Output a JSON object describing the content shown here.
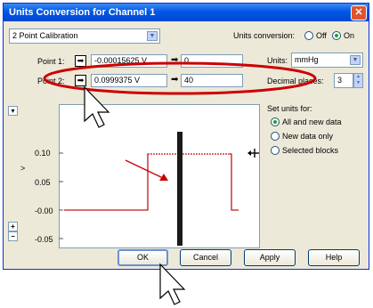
{
  "window": {
    "title": "Units Conversion for Channel 1",
    "close_glyph": "✕"
  },
  "calibration": {
    "mode_value": "2 Point Calibration"
  },
  "units_conversion": {
    "label": "Units conversion:",
    "off_label": "Off",
    "on_label": "On",
    "selected": "On"
  },
  "points": [
    {
      "label": "Point 1:",
      "raw_value": "-0.00015625 V",
      "converted_value": "0"
    },
    {
      "label": "Point 2:",
      "raw_value": "0.0999375 V",
      "converted_value": "40"
    }
  ],
  "units": {
    "label": "Units:",
    "value": "mmHg"
  },
  "decimal_places": {
    "label": "Decimal places:",
    "value": "3"
  },
  "set_units_for": {
    "label": "Set units for:",
    "options": [
      "All and new data",
      "New data only",
      "Selected blocks"
    ],
    "selected": "All and new data"
  },
  "chart": {
    "y_axis_symbol": ">",
    "tick_labels": [
      "0.10",
      "0.05",
      "-0.00",
      "-0.05"
    ],
    "signal_color": "#c4161c",
    "annotation_color": "#cc0000"
  },
  "footer": {
    "ok_label": "OK",
    "cancel_label": "Cancel",
    "apply_label": "Apply",
    "help_label": "Help"
  },
  "annotation": {
    "highlight_color": "#cc0000"
  }
}
